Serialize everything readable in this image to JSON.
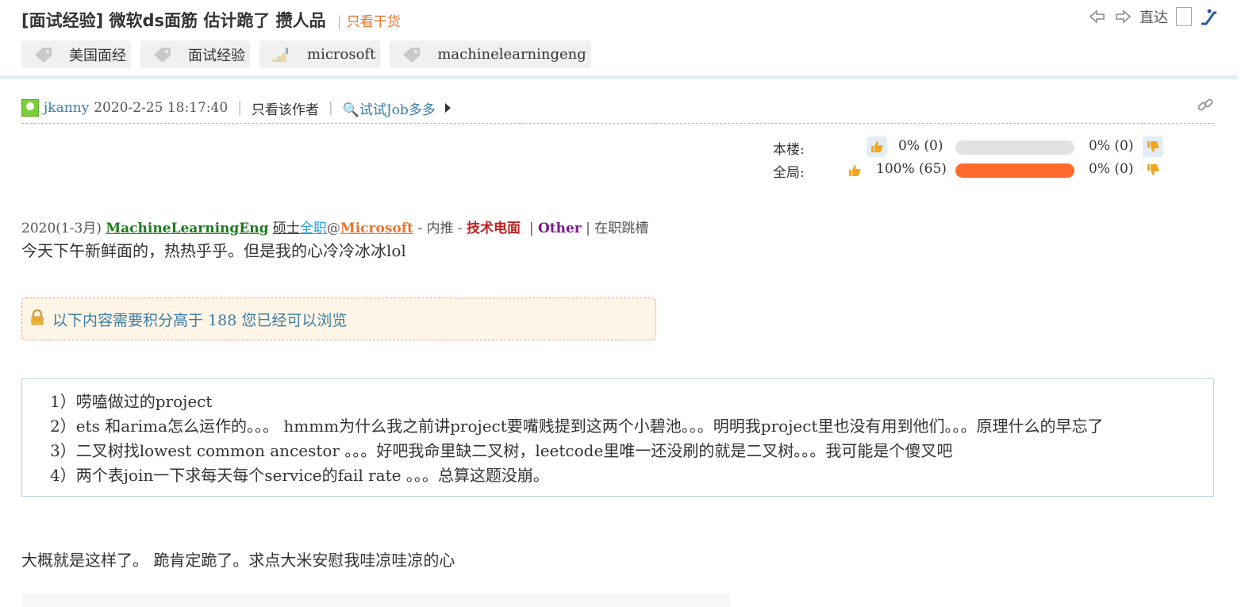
{
  "header": {
    "title": "[面试经验] 微软ds面筋 估计跪了 攒人品",
    "only_good": "只看干货",
    "goto_label": "直达"
  },
  "tags": [
    {
      "label": "美国面经",
      "icon": "tag-icon"
    },
    {
      "label": "面试经验",
      "icon": "tag-icon"
    },
    {
      "label": "microsoft",
      "icon": "stairs-icon"
    },
    {
      "label": "machinelearningeng",
      "icon": "tag-icon"
    }
  ],
  "post": {
    "author": "jkanny",
    "datetime": "2020-2-25 18:17:40",
    "only_author": "只看该作者",
    "jobs_link": "🔍试试Job多多"
  },
  "votes": {
    "floor": {
      "label": "本楼:",
      "up": "0% (0)",
      "down": "0% (0)",
      "up_fraction": 0.0
    },
    "global": {
      "label": "全局:",
      "up": "100% (65)",
      "down": "0% (0)",
      "up_fraction": 1.0
    },
    "colors": {
      "bar_fill": "#ff6a2a",
      "bar_bg": "#e2e2e2"
    }
  },
  "meta": {
    "time": "2020(1-3月)",
    "category": "MachineLearningEng",
    "degree": "硕士",
    "fulltime": "全职",
    "at": "@",
    "company": "Microsoft",
    "referral": "- 内推 -",
    "interview_type": "技术电面",
    "bar": "|",
    "other": "Other",
    "status": "| 在职跳槽"
  },
  "content": {
    "intro": "今天下午新鲜面的，热热乎乎。但是我的心冷冷冰冰lol",
    "locked_notice": "以下内容需要积分高于 188 您已经可以浏览",
    "questions": [
      "1）唠嗑做过的project",
      "2）ets 和arima怎么运作的。。。 hmmm为什么我之前讲project要嘴贱提到这两个小碧池。。。明明我project里也没有用到他们。。。原理什么的早忘了",
      "3）二叉树找lowest common ancestor 。。。好吧我命里缺二叉树，leetcode里唯一还没刷的就是二叉树。。。我可能是个傻叉吧",
      "4）两个表join一下求每天每个service的fail rate 。。。总算这题没崩。"
    ],
    "outro": "大概就是这样了。 跪肯定跪了。求点大米安慰我哇凉哇凉的心"
  }
}
